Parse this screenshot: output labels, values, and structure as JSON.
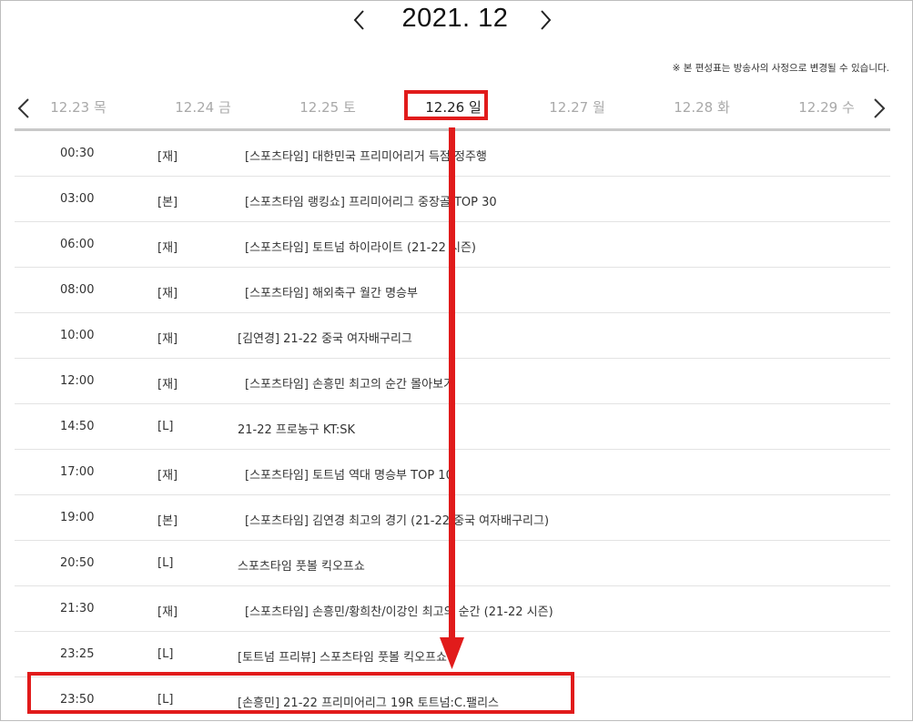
{
  "header": {
    "month_title": "2021. 12",
    "notice": "※ 본 편성표는 방송사의 사정으로 변경될 수 있습니다."
  },
  "day_tabs": [
    {
      "label": "12.23 목"
    },
    {
      "label": "12.24 금"
    },
    {
      "label": "12.25 토"
    },
    {
      "label": "12.26 일"
    },
    {
      "label": "12.27 월"
    },
    {
      "label": "12.28 화"
    },
    {
      "label": "12.29 수"
    }
  ],
  "selected_day": "12.26 일",
  "schedule": [
    {
      "time": "00:30",
      "tag": "[재]",
      "title": "[스포츠타임] 대한민국 프리미어리거 득점 정주행"
    },
    {
      "time": "03:00",
      "tag": "[본]",
      "title": "[스포츠타임 랭킹쇼] 프리미어리그 중장골 TOP 30"
    },
    {
      "time": "06:00",
      "tag": "[재]",
      "title": "[스포츠타임] 토트넘 하이라이트 (21-22 시즌)"
    },
    {
      "time": "08:00",
      "tag": "[재]",
      "title": "[스포츠타임] 해외축구 월간 명승부"
    },
    {
      "time": "10:00",
      "tag": "[재]",
      "title": "[김연경] 21-22 중국 여자배구리그"
    },
    {
      "time": "12:00",
      "tag": "[재]",
      "title": "[스포츠타임] 손흥민 최고의 순간 몰아보기"
    },
    {
      "time": "14:50",
      "tag": "[L]",
      "title": "21-22 프로농구 KT:SK"
    },
    {
      "time": "17:00",
      "tag": "[재]",
      "title": "[스포츠타임] 토트넘 역대 명승부 TOP 10"
    },
    {
      "time": "19:00",
      "tag": "[본]",
      "title": "[스포츠타임] 김연경 최고의 경기 (21-22 중국 여자배구리그)"
    },
    {
      "time": "20:50",
      "tag": "[L]",
      "title": "스포츠타임 풋볼 킥오프쇼"
    },
    {
      "time": "21:30",
      "tag": "[재]",
      "title": "[스포츠타임] 손흥민/황희찬/이강인 최고의 순간 (21-22 시즌)"
    },
    {
      "time": "23:25",
      "tag": "[L]",
      "title": "[토트넘 프리뷰] 스포츠타임 풋볼 킥오프쇼"
    },
    {
      "time": "23:50",
      "tag": "[L]",
      "title": "[손흥민] 21-22 프리미어리그 19R 토트넘:C.팰리스"
    }
  ],
  "colors": {
    "highlight": "#e11b1b",
    "inactive_tab": "#a9a9a9",
    "divider": "#e3e3e3"
  },
  "icons": {
    "month_prev": "chevron-left-icon",
    "month_next": "chevron-right-icon",
    "day_prev": "chevron-left-icon",
    "day_next": "chevron-right-icon"
  }
}
